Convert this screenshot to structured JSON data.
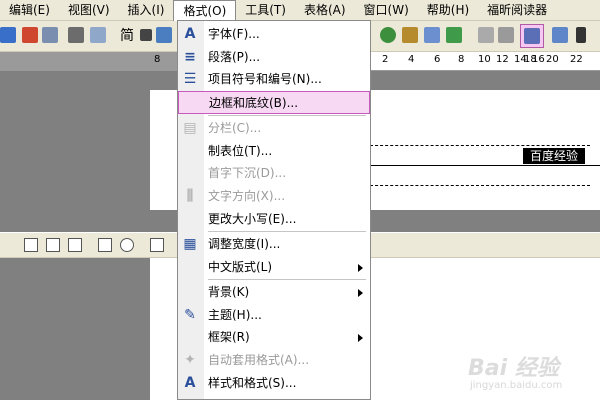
{
  "menubar": {
    "items": [
      {
        "label": "编辑(E)"
      },
      {
        "label": "视图(V)"
      },
      {
        "label": "插入(I)"
      },
      {
        "label": "格式(O)"
      },
      {
        "label": "工具(T)"
      },
      {
        "label": "表格(A)"
      },
      {
        "label": "窗口(W)"
      },
      {
        "label": "帮助(H)"
      },
      {
        "label": "福昕阅读器"
      }
    ]
  },
  "toolbar": {
    "style_glyph": "简",
    "style_icon": "brush-icon"
  },
  "ruler": {
    "ticks": [
      "8",
      "2",
      "4",
      "6",
      "8",
      "10",
      "12",
      "14",
      "16",
      "18",
      "20",
      "22"
    ]
  },
  "document": {
    "label": "百度经验"
  },
  "format_menu": {
    "items": [
      {
        "label": "字体(F)...",
        "icon": "font-icon",
        "enabled": true
      },
      {
        "label": "段落(P)...",
        "icon": "paragraph-icon",
        "enabled": true
      },
      {
        "label": "项目符号和编号(N)...",
        "icon": "bullets-icon",
        "enabled": true
      },
      {
        "label": "边框和底纹(B)...",
        "icon": "",
        "enabled": true,
        "highlighted": true
      },
      {
        "label": "分栏(C)...",
        "icon": "columns-icon",
        "enabled": false
      },
      {
        "label": "制表位(T)...",
        "icon": "",
        "enabled": true
      },
      {
        "label": "首字下沉(D)...",
        "icon": "",
        "enabled": false
      },
      {
        "label": "文字方向(X)...",
        "icon": "text-direction-icon",
        "enabled": false
      },
      {
        "label": "更改大小写(E)...",
        "icon": "",
        "enabled": true
      },
      {
        "label": "调整宽度(I)...",
        "icon": "fit-width-icon",
        "enabled": true
      },
      {
        "label": "中文版式(L)",
        "icon": "",
        "enabled": true,
        "submenu": true
      },
      {
        "label": "背景(K)",
        "icon": "",
        "enabled": true,
        "submenu": true
      },
      {
        "label": "主题(H)...",
        "icon": "theme-icon",
        "enabled": true
      },
      {
        "label": "框架(R)",
        "icon": "",
        "enabled": true,
        "submenu": true
      },
      {
        "label": "自动套用格式(A)...",
        "icon": "autoformat-icon",
        "enabled": false
      },
      {
        "label": "样式和格式(S)...",
        "icon": "styles-icon",
        "enabled": true
      }
    ]
  },
  "watermark": {
    "logo": "Bai 经验",
    "url": "jingyan.baidu.com"
  },
  "colors": {
    "menu_highlight": "#f8d9f4",
    "highlight_border": "#c65bbd",
    "chrome": "#ece9d8"
  }
}
